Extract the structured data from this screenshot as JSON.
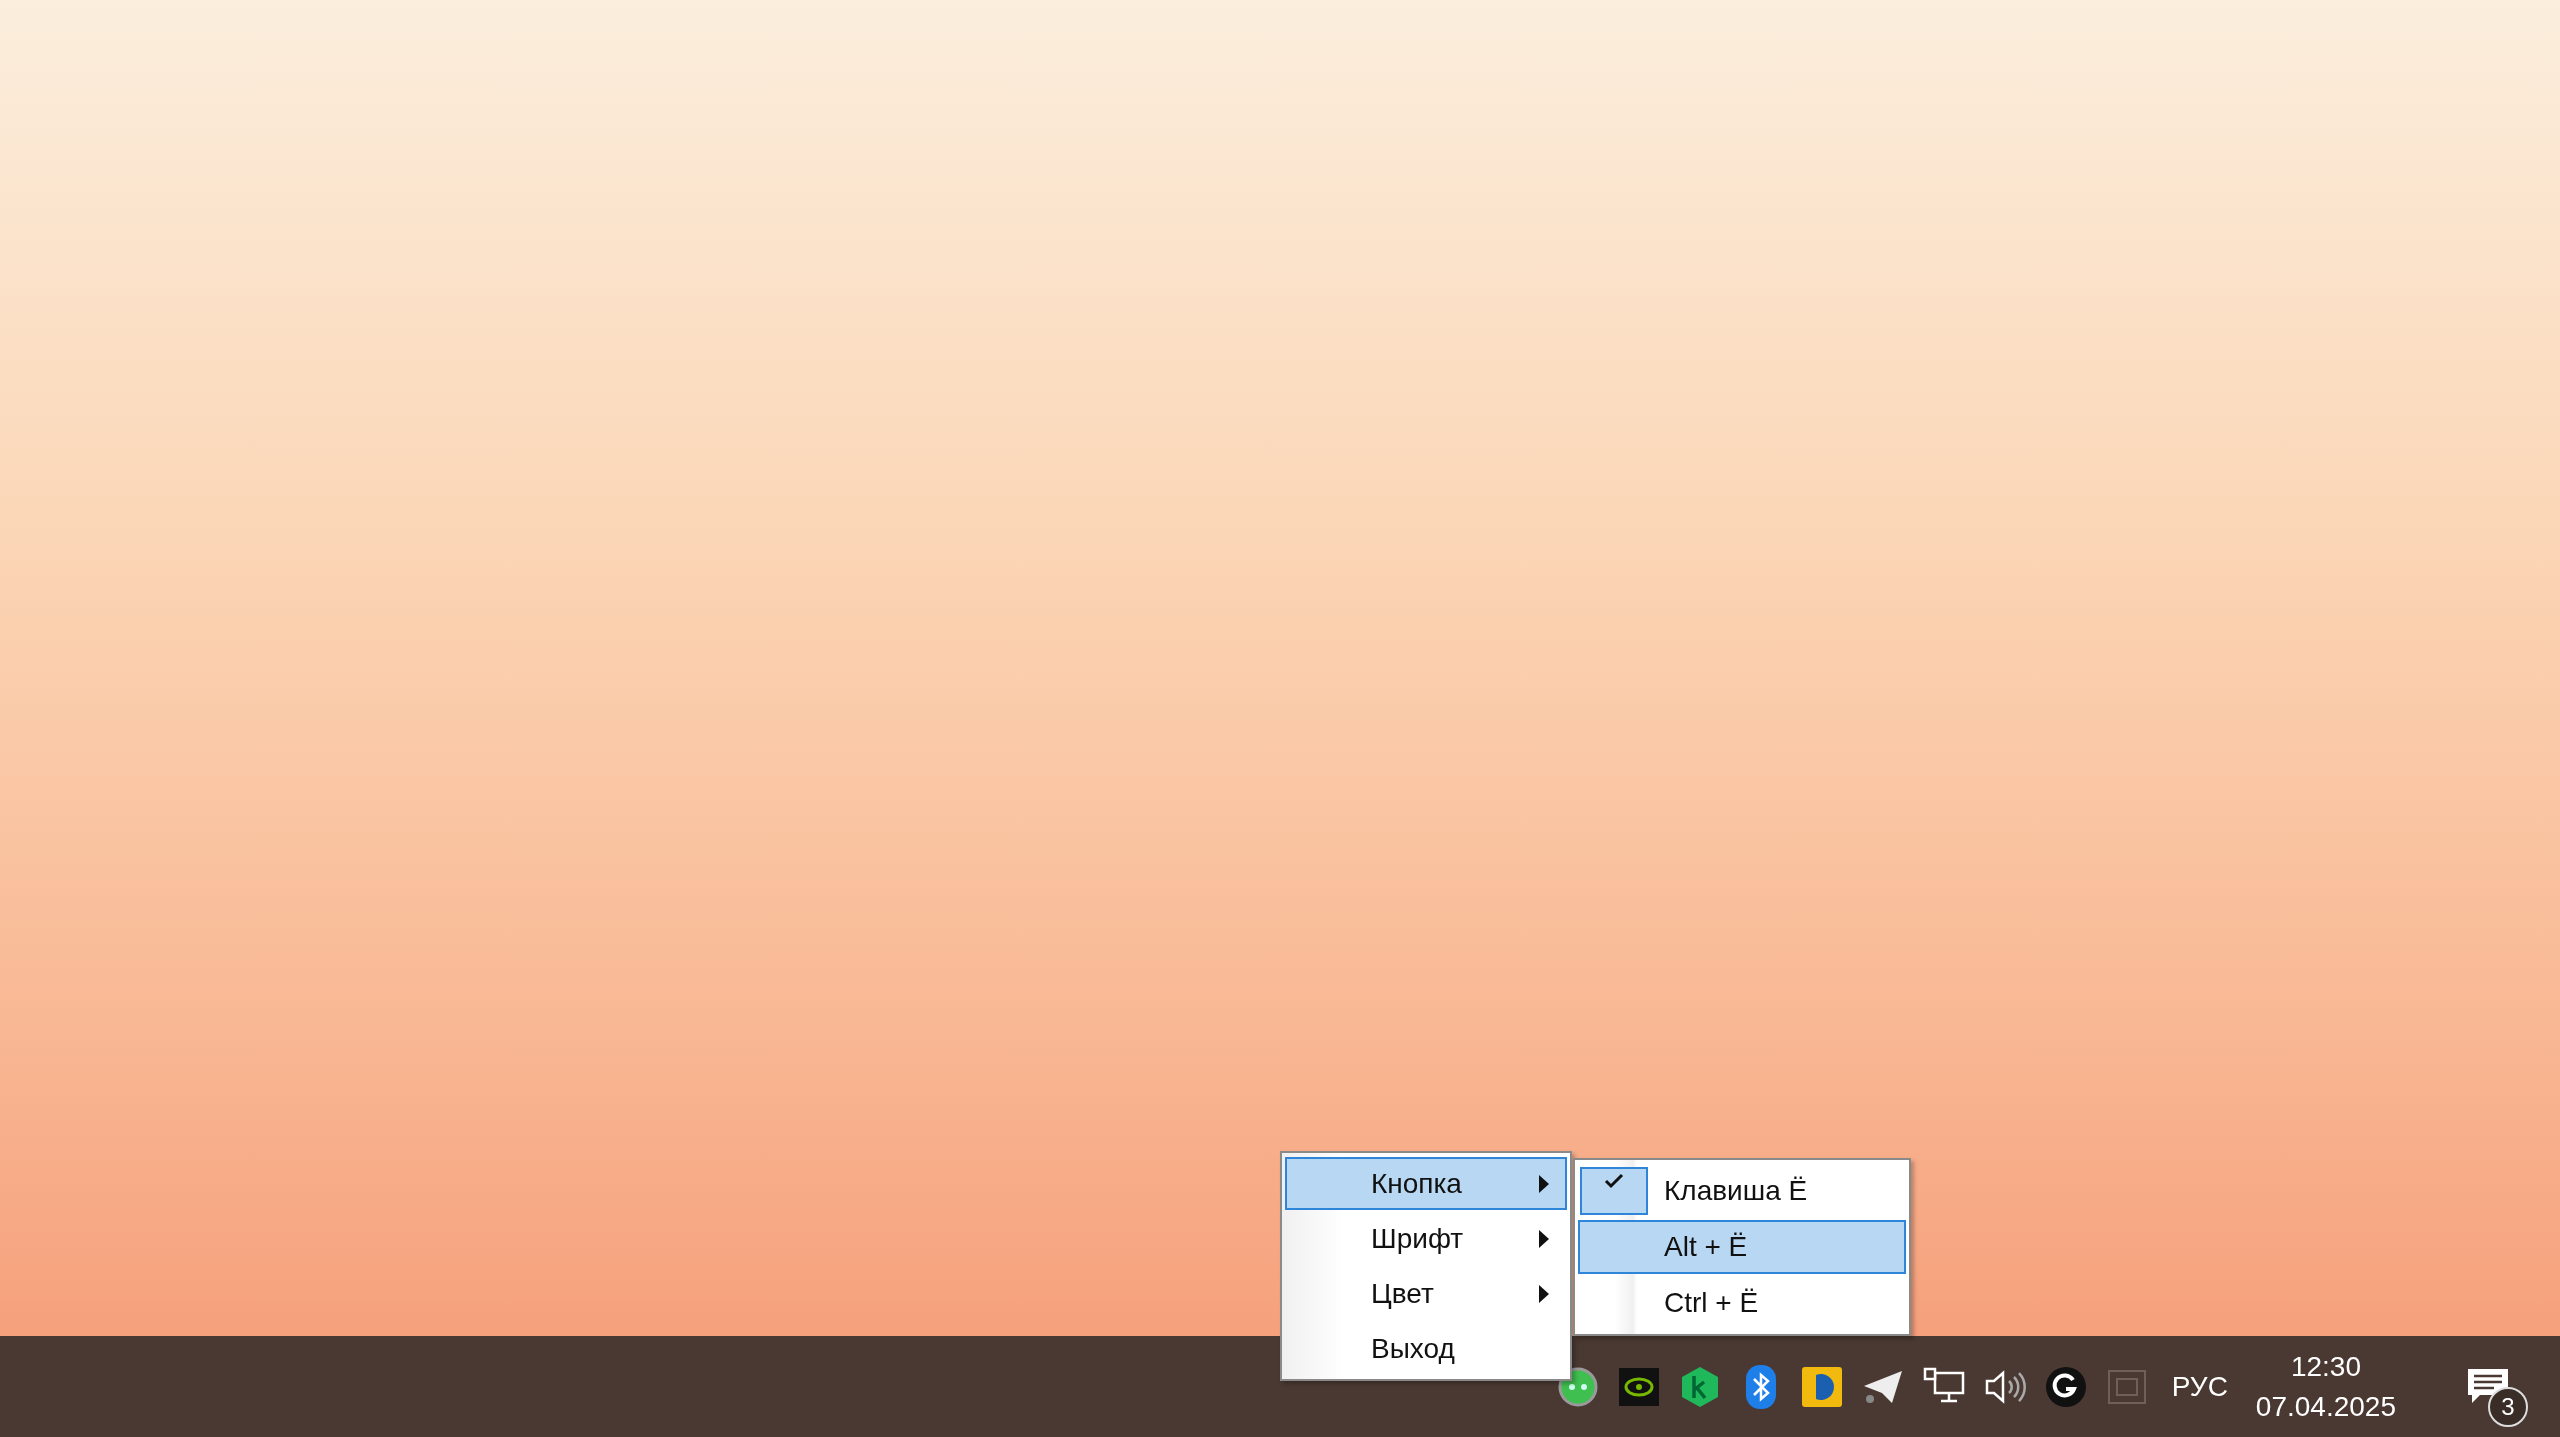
{
  "context_menu": {
    "items": [
      {
        "label": "Кнопка",
        "has_submenu": true,
        "selected": true
      },
      {
        "label": "Шрифт",
        "has_submenu": true,
        "selected": false
      },
      {
        "label": "Цвет",
        "has_submenu": true,
        "selected": false
      },
      {
        "label": "Выход",
        "has_submenu": false,
        "selected": false
      }
    ]
  },
  "submenu": {
    "items": [
      {
        "label": "Клавиша Ё",
        "checked": true,
        "selected": false
      },
      {
        "label": "Alt + Ё",
        "checked": false,
        "selected": true
      },
      {
        "label": "Ctrl + Ё",
        "checked": false,
        "selected": false
      }
    ]
  },
  "taskbar": {
    "tray_icons": [
      {
        "kind": "green"
      },
      {
        "kind": "gpu"
      },
      {
        "kind": "hexagon"
      },
      {
        "kind": "bluetooth"
      },
      {
        "kind": "yellow"
      },
      {
        "kind": "plane"
      },
      {
        "kind": "network"
      },
      {
        "kind": "volume"
      },
      {
        "kind": "g"
      },
      {
        "kind": "grey"
      }
    ],
    "language": "РУС",
    "time": "12:30",
    "date": "07.04.2025",
    "notification_count": "3"
  }
}
